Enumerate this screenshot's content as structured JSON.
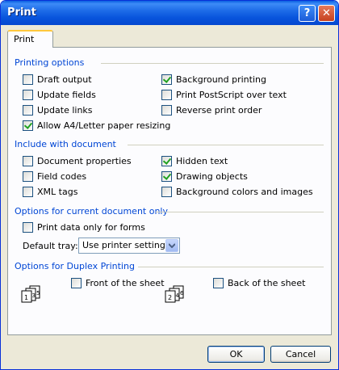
{
  "window": {
    "title": "Print",
    "help_label": "?",
    "close_label": "✕"
  },
  "tab": {
    "label": "Print"
  },
  "groups": {
    "printing_options": "Printing options",
    "include_with_document": "Include with document",
    "options_current_doc": "Options for current document only",
    "options_duplex": "Options for Duplex Printing"
  },
  "printing_options": {
    "draft_output": {
      "label": "Draft output",
      "checked": false
    },
    "update_fields": {
      "label": "Update fields",
      "checked": false
    },
    "update_links": {
      "label": "Update links",
      "checked": false
    },
    "allow_a4": {
      "label": "Allow A4/Letter paper resizing",
      "checked": true
    },
    "background_printing": {
      "label": "Background printing",
      "checked": true
    },
    "print_postscript": {
      "label": "Print PostScript over text",
      "checked": false
    },
    "reverse_order": {
      "label": "Reverse print order",
      "checked": false
    }
  },
  "include": {
    "document_properties": {
      "label": "Document properties",
      "checked": false
    },
    "field_codes": {
      "label": "Field codes",
      "checked": false
    },
    "xml_tags": {
      "label": "XML tags",
      "checked": false
    },
    "hidden_text": {
      "label": "Hidden text",
      "checked": true
    },
    "drawing_objects": {
      "label": "Drawing objects",
      "checked": true
    },
    "background_colors": {
      "label": "Background colors and images",
      "checked": false
    }
  },
  "current_doc": {
    "print_data_only": {
      "label": "Print data only for forms",
      "checked": false
    },
    "default_tray_label": "Default tray:",
    "default_tray_value": "Use printer settings"
  },
  "duplex": {
    "front": {
      "label": "Front of the sheet",
      "checked": false
    },
    "back": {
      "label": "Back of the sheet",
      "checked": false
    },
    "front_icon_pages": "1 3 5",
    "back_icon_pages": "2 4 6"
  },
  "buttons": {
    "ok": "OK",
    "cancel": "Cancel"
  }
}
